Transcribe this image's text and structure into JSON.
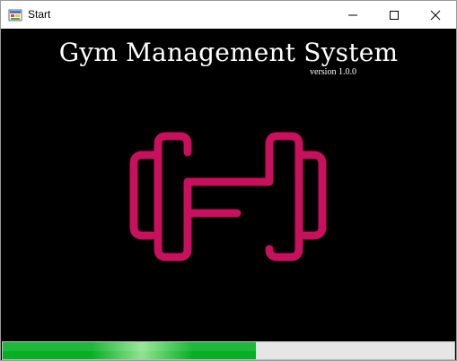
{
  "window": {
    "title": "Start",
    "controls": {
      "minimize_icon": "minimize-icon",
      "maximize_icon": "maximize-icon",
      "close_icon": "close-icon"
    }
  },
  "splash": {
    "heading": "Gym Management System",
    "version": "version 1.0.0",
    "logo_icon": "dumbbell-icon",
    "logo_color": "#c8105c",
    "background_color": "#000000"
  },
  "progress": {
    "fraction": 0.56,
    "fill_color": "#06b025"
  }
}
